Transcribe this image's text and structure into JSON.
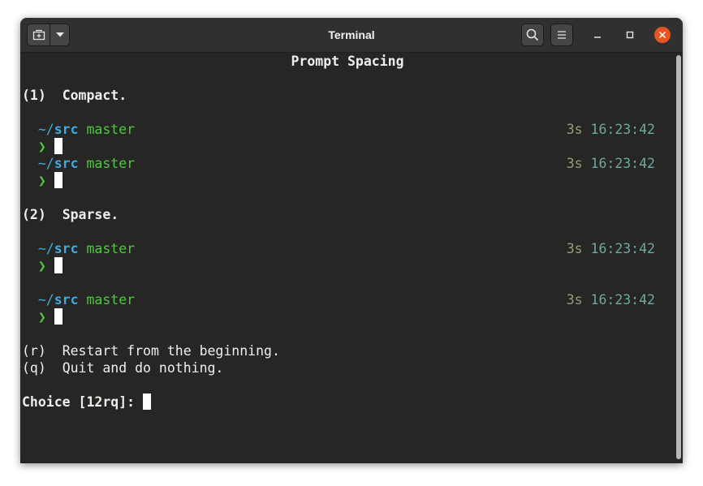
{
  "window": {
    "title": "Terminal",
    "icons": {
      "new_tab": "new-tab-icon",
      "dropdown": "chevron-down-icon",
      "search": "search-icon",
      "menu": "hamburger-menu-icon",
      "minimize": "minimize-icon",
      "maximize": "maximize-icon",
      "close": "close-icon"
    },
    "colors": {
      "close_button": "#e95420",
      "background": "#262624",
      "path": "#3fa9e0",
      "branch": "#4ec93e",
      "duration": "#9b9b76",
      "time": "#6fa7a3"
    }
  },
  "terminal": {
    "heading": "Prompt Spacing",
    "option1": {
      "key": "(1)",
      "label": "Compact."
    },
    "option2": {
      "key": "(2)",
      "label": "Sparse."
    },
    "prompt": {
      "tilde": "~/",
      "dir": "src",
      "branch": "master",
      "chevron": "❯",
      "duration": "3s",
      "time": "16:23:42"
    },
    "option_r": {
      "key": "(r)",
      "label": "Restart from the beginning."
    },
    "option_q": {
      "key": "(q)",
      "label": "Quit and do nothing."
    },
    "choice_prompt": "Choice [12rq]: "
  }
}
